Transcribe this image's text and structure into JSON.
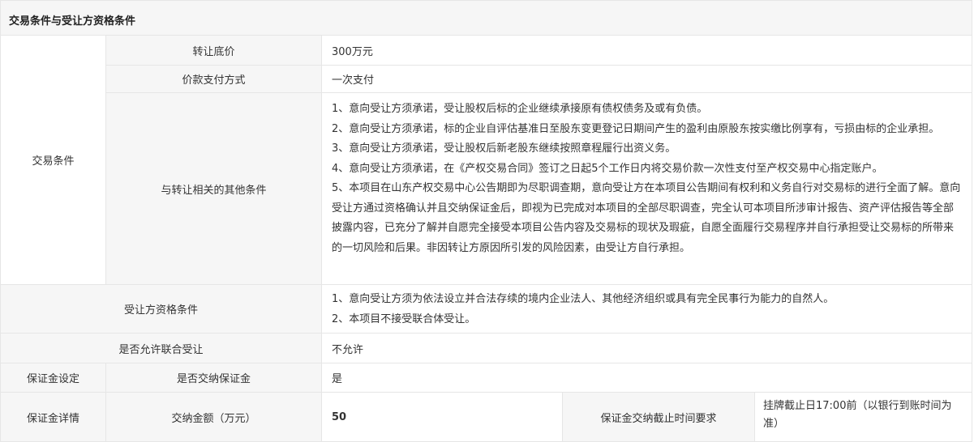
{
  "section": {
    "title": "交易条件与受让方资格条件"
  },
  "trade": {
    "group_label": "交易条件",
    "base_price_label": "转让底价",
    "base_price_value": "300万元",
    "payment_label": "价款支付方式",
    "payment_value": "一次支付",
    "other_label": "与转让相关的其他条件",
    "other_conditions": [
      "1、意向受让方须承诺，受让股权后标的企业继续承接原有债权债务及或有负债。",
      "2、意向受让方须承诺，标的企业自评估基准日至股东变更登记日期间产生的盈利由原股东按实缴比例享有，亏损由标的企业承担。",
      "3、意向受让方须承诺，受让股权后新老股东继续按照章程履行出资义务。",
      "4、意向受让方须承诺，在《产权交易合同》签订之日起5个工作日内将交易价款一次性支付至产权交易中心指定账户。",
      "5、本项目在山东产权交易中心公告期即为尽职调查期，意向受让方在本项目公告期间有权利和义务自行对交易标的进行全面了解。意向受让方通过资格确认并且交纳保证金后，即视为已完成对本项目的全部尽职调查，完全认可本项目所涉审计报告、资产评估报告等全部披露内容，已充分了解并自愿完全接受本项目公告内容及交易标的现状及瑕疵，自愿全面履行交易程序并自行承担受让交易标的所带来的一切风险和后果。非因转让方原因所引发的风险因素，由受让方自行承担。"
    ]
  },
  "qualification": {
    "label": "受让方资格条件",
    "items": [
      "1、意向受让方须为依法设立并合法存续的境内企业法人、其他经济组织或具有完全民事行为能力的自然人。",
      "2、本项目不接受联合体受让。"
    ]
  },
  "joint": {
    "label": "是否允许联合受让",
    "value": "不允许"
  },
  "deposit_setting": {
    "label": "保证金设定",
    "required_label": "是否交纳保证金",
    "required_value": "是"
  },
  "deposit_detail": {
    "label": "保证金详情",
    "amount_label": "交纳金额（万元）",
    "amount_value": "50",
    "deadline_label": "保证金交纳截止时间要求",
    "deadline_value": "挂牌截止日17:00前（以银行到账时间为准）"
  }
}
